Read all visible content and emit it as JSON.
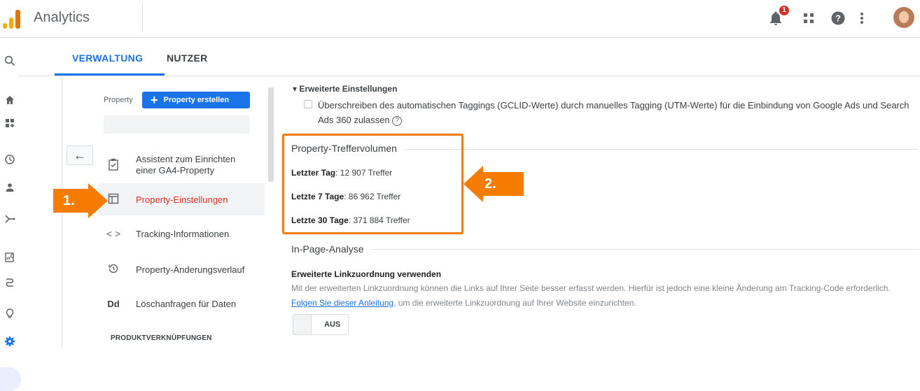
{
  "header": {
    "app_title": "Analytics",
    "notification_count": "1",
    "icons": [
      "bell-icon",
      "apps-grid-icon",
      "help-icon",
      "more-vert-icon",
      "avatar"
    ]
  },
  "tabs": [
    {
      "label": "VERWALTUNG",
      "active": true
    },
    {
      "label": "NUTZER",
      "active": false
    }
  ],
  "left_rail": [
    "search-icon",
    "home-icon",
    "customization-icon",
    "realtime-icon",
    "audience-icon",
    "acquisition-icon",
    "reports-icon",
    "attribution-icon",
    "discover-icon",
    "admin-gear-icon"
  ],
  "property_panel": {
    "property_label": "Property",
    "create_button": "Property erstellen",
    "items": [
      {
        "label": "Assistent zum Einrichten einer GA4-Property",
        "icon": "checklist-icon",
        "active": false
      },
      {
        "label": "Property-Einstellungen",
        "icon": "settings-panel-icon",
        "active": true
      },
      {
        "label": "Tracking-Informationen",
        "icon": "code-icon",
        "active": false
      },
      {
        "label": "Property-Änderungsverlauf",
        "icon": "history-icon",
        "active": false
      },
      {
        "label": "Löschanfragen für Daten",
        "icon": "dd-icon",
        "active": false
      }
    ],
    "product_links_heading": "PRODUKTVERKNÜPFUNGEN"
  },
  "advanced": {
    "heading": "Erweiterte Einstellungen",
    "checkbox_text": "Überschreiben des automatischen Taggings (GCLID-Werte) durch manuelles Tagging (UTM-Werte) für die Einbindung von Google Ads und Search Ads 360 zulassen",
    "checked": false
  },
  "hit_volume": {
    "title": "Property-Treffervolumen",
    "stats": [
      {
        "label": "Letzter Tag",
        "value": ": 12 907 Treffer"
      },
      {
        "label": "Letzte 7 Tage",
        "value": ": 86 962 Treffer"
      },
      {
        "label": "Letzte 30 Tage",
        "value": ": 371 884 Treffer"
      }
    ]
  },
  "in_page": {
    "title": "In-Page-Analyse",
    "subheading": "Erweiterte Linkzuordnung verwenden",
    "text_before": "Mit der erweiterten Linkzuordnung können die Links auf Ihrer Seite besser erfasst werden. Hierfür ist jedoch eine kleine Änderung am Tracking-Code erforderlich. ",
    "link_text": "Folgen Sie dieser Anleitung",
    "text_after": ", um die erweiterte Linkzuordnung auf Ihrer Website einzurichten.",
    "toggle_label": "AUS"
  },
  "annotations": {
    "callout_1": "1.",
    "callout_2": "2."
  },
  "colors": {
    "accent": "#1a73e8",
    "highlight": "#f57c00",
    "active_nav": "#d93025"
  }
}
